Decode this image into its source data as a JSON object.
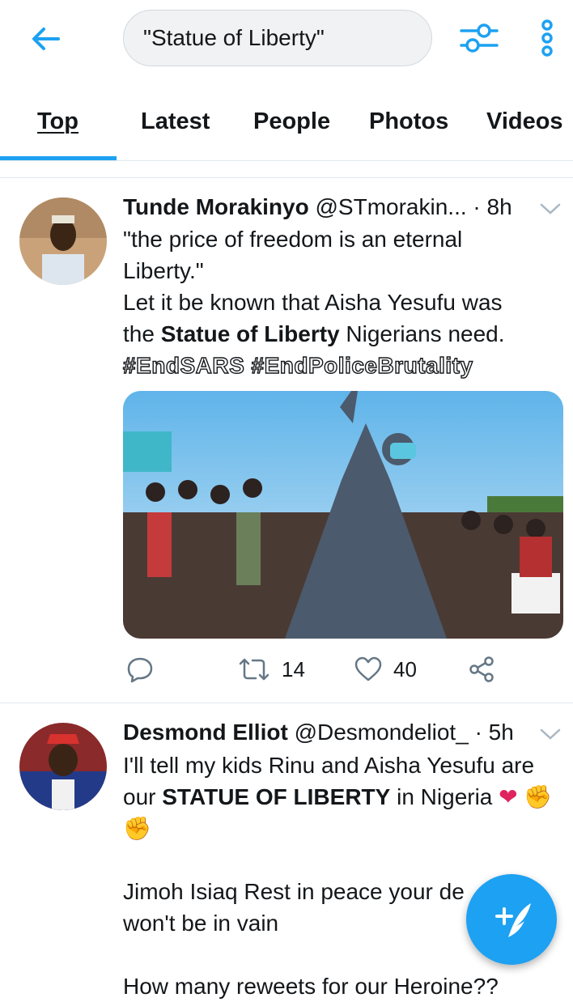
{
  "search": {
    "query": "\"Statue of Liberty\""
  },
  "tabs": [
    {
      "label": "Top"
    },
    {
      "label": "Latest"
    },
    {
      "label": "People"
    },
    {
      "label": "Photos"
    },
    {
      "label": "Videos"
    }
  ],
  "colors": {
    "accent": "#1da1f2",
    "text": "#14171a",
    "divider": "#e1e8ed"
  },
  "tweets": [
    {
      "name": "Tunde Morakinyo",
      "handle": "@STmorakin...",
      "time": "· 8h",
      "line1": "\"the price of freedom is an eternal",
      "line2": "Liberty.\"",
      "line3": "Let it be known that Aisha Yesufu was",
      "line4_pre": "the ",
      "line4_bold": "Statue of Liberty",
      "line4_post": " Nigerians need.",
      "hashtags": "#EndSARS #EndPoliceBrutality",
      "replies": "",
      "retweets": "14",
      "likes": "40"
    },
    {
      "name": "Desmond Elliot",
      "handle": "@Desmondeliot_",
      "time": "· 5h",
      "line1": "I'll tell my kids Rinu and Aisha Yesufu are",
      "line2_pre": "our ",
      "line2_bold": "STATUE OF LIBERTY",
      "line2_post": " in Nigeria",
      "line3": "Jimoh Isiaq Rest in peace your de",
      "line4": "won't be in vain",
      "line5": "How many reweets for our Heroine??"
    }
  ],
  "icons": [
    "back-arrow-icon",
    "filter-icon",
    "more-vertical-icon",
    "chevron-down-icon",
    "reply-icon",
    "retweet-icon",
    "like-icon",
    "share-icon",
    "compose-tweet-icon"
  ]
}
